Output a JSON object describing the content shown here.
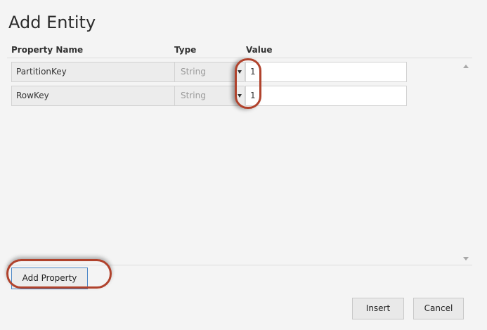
{
  "dialog": {
    "title": "Add Entity"
  },
  "columns": {
    "name": "Property Name",
    "type": "Type",
    "value": "Value"
  },
  "rows": [
    {
      "name": "PartitionKey",
      "type": "String",
      "value": "1"
    },
    {
      "name": "RowKey",
      "type": "String",
      "value": "1"
    }
  ],
  "buttons": {
    "add_property": "Add Property",
    "insert": "Insert",
    "cancel": "Cancel"
  },
  "colors": {
    "highlight": "#b0422c",
    "focus_border": "#4e88c7",
    "background": "#f4f4f4"
  }
}
